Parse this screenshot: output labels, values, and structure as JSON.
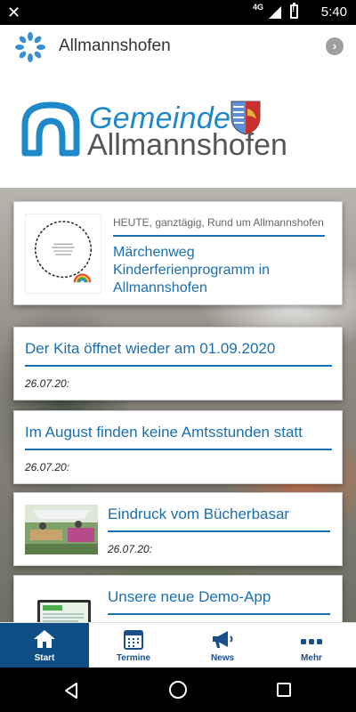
{
  "status_bar": {
    "network": "4G",
    "time": "5:40"
  },
  "app_bar": {
    "title": "Allmannshofen"
  },
  "banner": {
    "line1": "Gemeinde",
    "line2": "Allmannshofen"
  },
  "colors": {
    "brand_blue": "#1a6fb0",
    "tab_active": "#0f4d86",
    "crest_blue": "#5b8fd8",
    "crest_red": "#c9302c",
    "crest_gold": "#e3b23c"
  },
  "cards": [
    {
      "type": "event",
      "meta": "HEUTE, ganztägig, Rund um Allmannshofen",
      "headline": "Märchenweg Kinderferienprogramm in Allmannshofen"
    },
    {
      "type": "text",
      "headline": "Der Kita öffnet wieder am 01.09.2020",
      "date": "26.07.20:"
    },
    {
      "type": "text",
      "headline": "Im August finden keine Amtsstunden statt",
      "date": "26.07.20:"
    },
    {
      "type": "image",
      "headline": "Eindruck vom Bücherbasar",
      "date": "26.07.20:"
    },
    {
      "type": "image",
      "headline": "Unsere neue Demo-App",
      "date": ""
    }
  ],
  "tabs": [
    {
      "label": "Start",
      "icon": "home-icon",
      "active": true
    },
    {
      "label": "Termine",
      "icon": "calendar-icon",
      "active": false
    },
    {
      "label": "News",
      "icon": "megaphone-icon",
      "active": false
    },
    {
      "label": "Mehr",
      "icon": "more-icon",
      "active": false
    }
  ]
}
